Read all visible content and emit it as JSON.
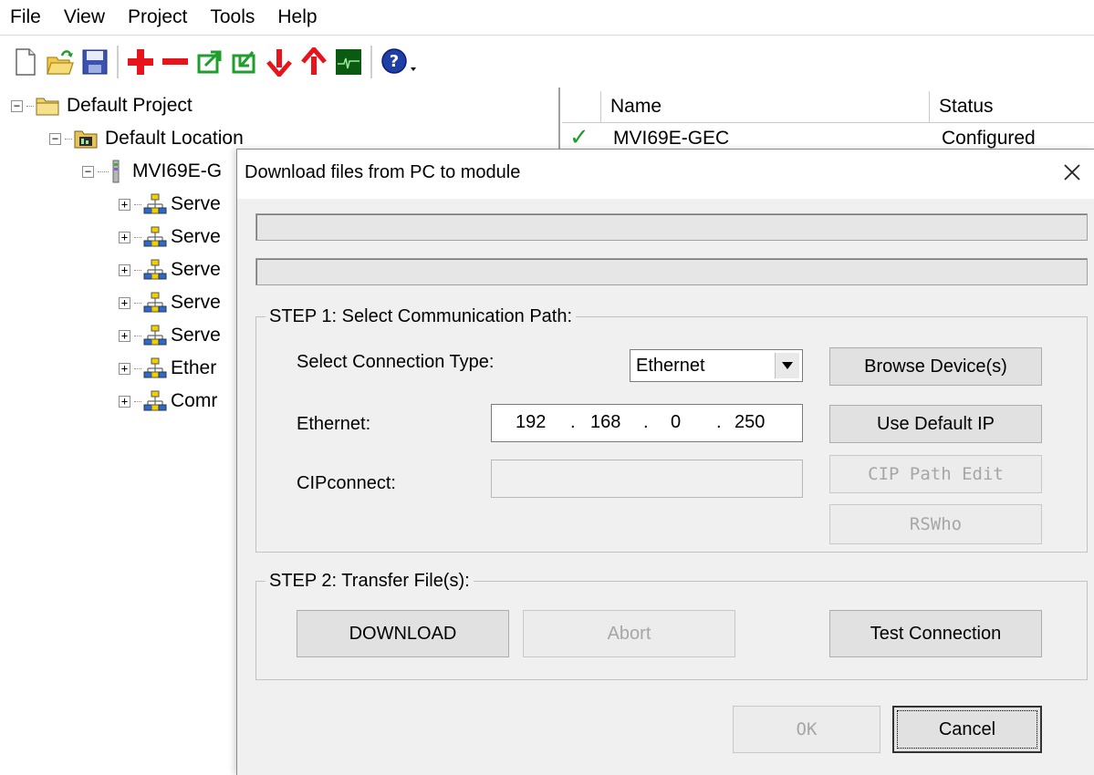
{
  "menu": [
    "File",
    "View",
    "Project",
    "Tools",
    "Help"
  ],
  "toolbar": {
    "icons": [
      "new-file-icon",
      "open-folder-icon",
      "save-icon",
      "add-icon",
      "remove-icon",
      "export-icon",
      "import-icon",
      "download-icon",
      "upload-icon",
      "diagnostics-icon",
      "help-icon"
    ],
    "colors": {
      "red": "#e8141c",
      "green": "#1e9e2a",
      "dark_green": "#0b5a12",
      "blue": "#1f3fa8"
    }
  },
  "tree": {
    "items": [
      {
        "label": "Default Project",
        "toggle": "−"
      },
      {
        "label": "Default Location",
        "toggle": "−"
      },
      {
        "label": "MVI69E-G",
        "toggle": "−"
      },
      {
        "label": "Serve",
        "toggle": "+"
      },
      {
        "label": "Serve",
        "toggle": "+"
      },
      {
        "label": "Serve",
        "toggle": "+"
      },
      {
        "label": "Serve",
        "toggle": "+"
      },
      {
        "label": "Serve",
        "toggle": "+"
      },
      {
        "label": "Ether",
        "toggle": "+"
      },
      {
        "label": "Comr",
        "toggle": "+"
      }
    ]
  },
  "list": {
    "columns": [
      "Name",
      "Status"
    ],
    "rows": [
      {
        "check": "✓",
        "name": "MVI69E-GEC",
        "status": "Configured"
      }
    ]
  },
  "dialog": {
    "title": "Download files from PC to module",
    "close": "✕",
    "step1": {
      "legend": "STEP 1: Select Communication Path:",
      "connection_type_label": "Select Connection Type:",
      "connection_type_value": "Ethernet",
      "ethernet_label": "Ethernet:",
      "ip": [
        "192",
        "168",
        "0",
        "250"
      ],
      "ip_dot": ".",
      "cipconnect_label": "CIPconnect:",
      "browse_button": "Browse Device(s)",
      "default_ip_button": "Use Default IP",
      "cip_path_button": "CIP Path Edit",
      "rswho_button": "RSWho"
    },
    "step2": {
      "legend": "STEP 2: Transfer File(s):",
      "download_button": "DOWNLOAD",
      "abort_button": "Abort",
      "test_button": "Test Connection"
    },
    "ok_button": "OK",
    "cancel_button": "Cancel"
  }
}
